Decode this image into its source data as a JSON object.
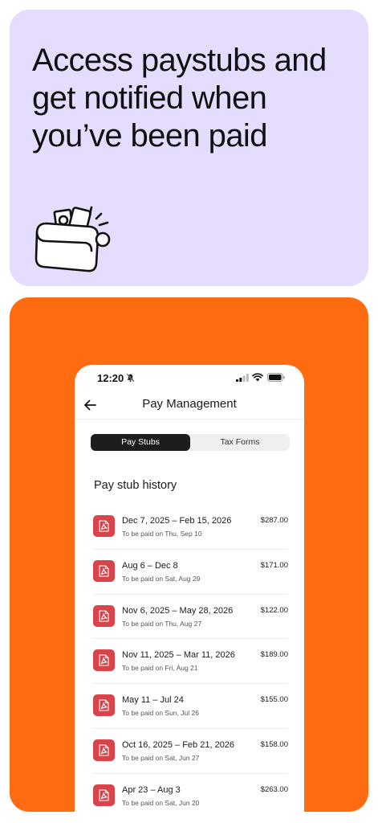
{
  "promo": {
    "headline": "Access paystubs and get notified when you’ve been paid",
    "illustration_icon": "wallet-with-cash-and-card-icon"
  },
  "colors": {
    "promo_bg": "#e6dcfd",
    "orange_bg": "#fd6c11",
    "pdf_badge": "#d9444b",
    "active_tab": "#1d1d1d"
  },
  "status_bar": {
    "time": "12:20",
    "icons": [
      "bell-slash-icon",
      "signal-icon",
      "wifi-icon",
      "battery-icon"
    ]
  },
  "nav": {
    "back_icon": "arrow-left-icon",
    "title": "Pay Management"
  },
  "tabs": [
    {
      "label": "Pay Stubs",
      "active": true
    },
    {
      "label": "Tax Forms",
      "active": false
    }
  ],
  "section_title": "Pay stub history",
  "stubs": [
    {
      "range": "Dec 7, 2025 – Feb 15, 2026",
      "sub": "To be paid on Thu, Sep 10",
      "amount": "$287.00"
    },
    {
      "range": "Aug 6 – Dec 8",
      "sub": "To be paid on Sat, Aug 29",
      "amount": "$171.00"
    },
    {
      "range": "Nov 6, 2025 – May 28, 2026",
      "sub": "To be paid on Thu, Aug 27",
      "amount": "$122.00"
    },
    {
      "range": "Nov 11, 2025 – Mar 11, 2026",
      "sub": "To be paid on Fri, Aug 21",
      "amount": "$189.00"
    },
    {
      "range": "May 11 – Jul 24",
      "sub": "To be paid on Sun, Jul 26",
      "amount": "$155.00"
    },
    {
      "range": "Oct 16, 2025 – Feb 21, 2026",
      "sub": "To be paid on Sat, Jun 27",
      "amount": "$158.00"
    },
    {
      "range": "Apr 23 – Aug 3",
      "sub": "To be paid on Sat, Jun 20",
      "amount": "$263.00"
    }
  ]
}
